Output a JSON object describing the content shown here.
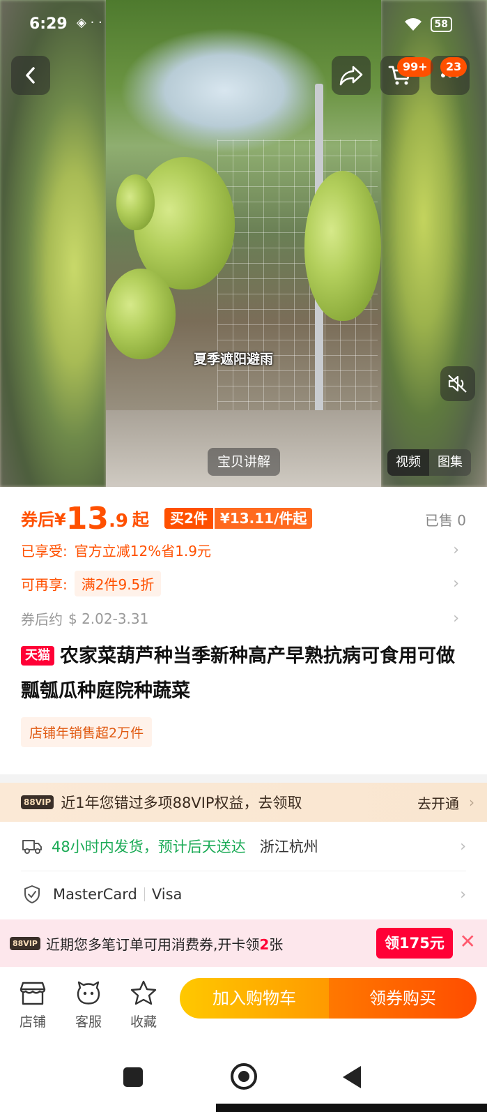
{
  "status_bar": {
    "time": "6:29",
    "signal_icons": "◈ · ·",
    "battery": "58"
  },
  "header": {
    "cart_badge": "99+",
    "message_badge": "23"
  },
  "media": {
    "caption": "夏季遮阳避雨",
    "explain_label": "宝贝讲解",
    "tabs": [
      "视频",
      "图集"
    ]
  },
  "price": {
    "prefix": "券后¥",
    "integer": "13",
    "decimal": ".9",
    "suffix": "起",
    "multi_a": "买2件",
    "multi_b": "¥13.11/件起",
    "sold": "已售 0"
  },
  "promos": {
    "enjoyed_label": "已享受:",
    "enjoyed_text": "官方立减12%省1.9元",
    "more_label": "可再享:",
    "more_text": "满2件9.5折",
    "approx_label": "券后约",
    "approx_text": "$ 2.02-3.31"
  },
  "product": {
    "tmall_tag": "天猫",
    "title": "农家菜葫芦种当季新种高产早熟抗病可食用可做瓢瓠瓜种庭院种蔬菜",
    "store_tag": "店铺年销售超2万件"
  },
  "vip": {
    "logo": "88VIP",
    "text": "近1年您错过多项88VIP权益，去领取",
    "action": "去开通"
  },
  "shipping": {
    "text": "48小时内发货，预计后天送达",
    "place": "浙江杭州"
  },
  "payment": {
    "methods": [
      "MasterCard",
      "Visa"
    ]
  },
  "coupon": {
    "logo": "88VIP",
    "text_before": "近期您多笔订单可用消费券,开卡领",
    "count": "2",
    "text_after": "张",
    "button": "领175元",
    "close": "✕"
  },
  "bottom_bar": {
    "tabs": [
      "店铺",
      "客服",
      "收藏"
    ],
    "add_to_cart": "加入购物车",
    "buy": "领券购买"
  },
  "colors": {
    "accent": "#ff5000",
    "tmall_red": "#ff0036",
    "ship_green": "#1aaa55"
  },
  "icons": [
    "back-icon",
    "share-icon",
    "cart-icon",
    "more-icon",
    "mute-icon",
    "truck-icon",
    "shield-icon",
    "store-icon",
    "service-icon",
    "star-icon"
  ]
}
